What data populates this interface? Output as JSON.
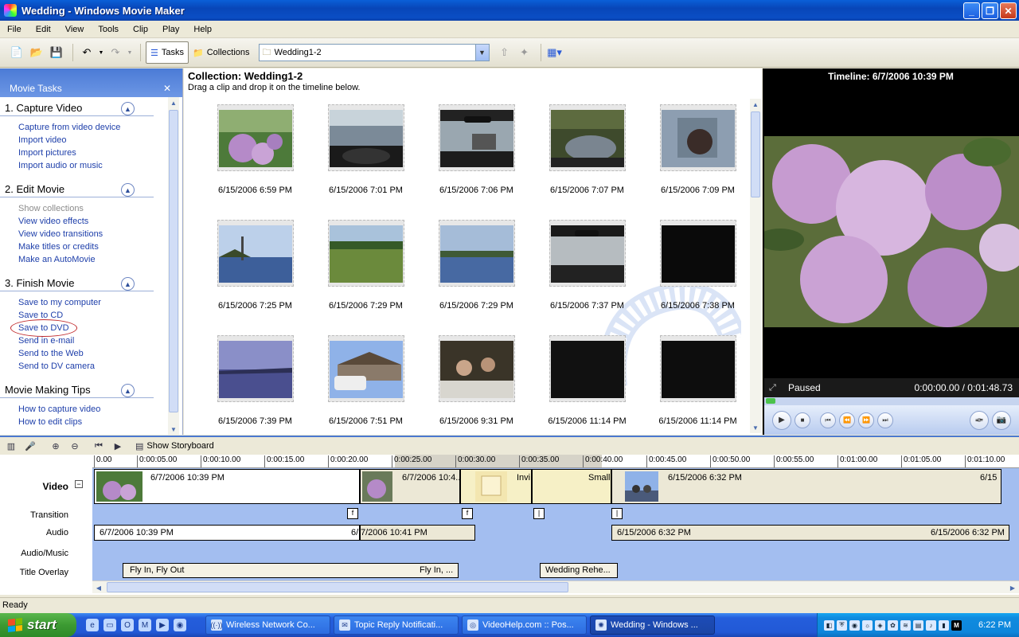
{
  "window": {
    "title": "Wedding - Windows Movie Maker"
  },
  "menu": [
    "File",
    "Edit",
    "View",
    "Tools",
    "Clip",
    "Play",
    "Help"
  ],
  "toolbar": {
    "tasks_label": "Tasks",
    "collections_label": "Collections",
    "collection_select": "Wedding1-2"
  },
  "taskpane": {
    "title": "Movie Tasks",
    "sections": [
      {
        "title": "1. Capture Video",
        "links": [
          "Capture from video device",
          "Import video",
          "Import pictures",
          "Import audio or music"
        ]
      },
      {
        "title": "2. Edit Movie",
        "links": [
          "Show collections",
          "View video effects",
          "View video transitions",
          "Make titles or credits",
          "Make an AutoMovie"
        ]
      },
      {
        "title": "3. Finish Movie",
        "links": [
          "Save to my computer",
          "Save to CD",
          "Save to DVD",
          "Send in e-mail",
          "Send to the Web",
          "Send to DV camera"
        ]
      },
      {
        "title": "Movie Making Tips",
        "links": [
          "How to capture video",
          "How to edit clips"
        ]
      }
    ]
  },
  "collection": {
    "title": "Collection: Wedding1-2",
    "hint": "Drag a clip and drop it on the timeline below.",
    "clips": [
      "6/15/2006 6:59 PM",
      "6/15/2006 7:01 PM",
      "6/15/2006 7:06 PM",
      "6/15/2006 7:07 PM",
      "6/15/2006 7:09 PM",
      "6/15/2006 7:25 PM",
      "6/15/2006 7:29 PM",
      "6/15/2006 7:29 PM",
      "6/15/2006 7:37 PM",
      "6/15/2006 7:38 PM",
      "6/15/2006 7:39 PM",
      "6/15/2006 7:51 PM",
      "6/15/2006 9:31 PM",
      "6/15/2006 11:14 PM",
      "6/15/2006 11:14 PM"
    ]
  },
  "preview": {
    "title": "Timeline: 6/7/2006 10:39 PM",
    "status": "Paused",
    "time": "0:00:00.00 / 0:01:48.73"
  },
  "timeline": {
    "show_storyboard": "Show Storyboard",
    "ruler": [
      "0.00",
      "0:00:05.00",
      "0:00:10.00",
      "0:00:15.00",
      "0:00:20.00",
      "0:00:25.00",
      "0:00:30.00",
      "0:00:35.00",
      "0:00:40.00",
      "0:00:45.00",
      "0:00:50.00",
      "0:00:55.00",
      "0:01:00.00",
      "0:01:05.00",
      "0:01:10.00"
    ],
    "labels": {
      "video": "Video",
      "transition": "Transition",
      "audio": "Audio",
      "audio_music": "Audio/Music",
      "title_overlay": "Title Overlay"
    },
    "video_clips": [
      "6/7/2006 10:39 PM",
      "6/7/2006 10:4...",
      "Invi...",
      "Small...",
      "6/15/2006 6:32 PM",
      "6/15"
    ],
    "transitions": [
      "f",
      "f",
      "|",
      "|"
    ],
    "audio_clips": [
      "6/7/2006 10:39 PM",
      "6/",
      "7/2006 10:41 PM",
      "6/15/2006 6:32 PM",
      "6/15/2006 6:32 PM"
    ],
    "title_overlays": [
      "Fly In, Fly Out",
      "Fly In, ...",
      "Wedding Rehe..."
    ]
  },
  "statusbar": {
    "text": "Ready"
  },
  "taskbar": {
    "start": "start",
    "tasks": [
      "Wireless Network Co...",
      "Topic Reply Notificati...",
      "VideoHelp.com :: Pos...",
      "Wedding - Windows ..."
    ],
    "clock": "6:22 PM"
  }
}
